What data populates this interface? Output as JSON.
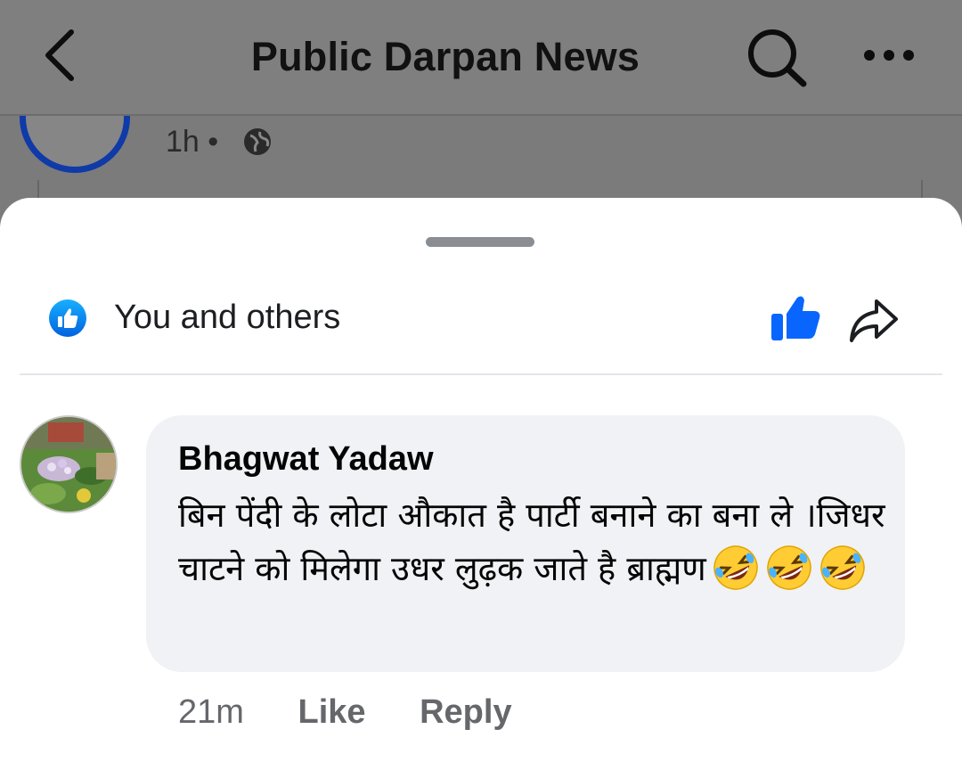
{
  "header": {
    "title": "Public Darpan News",
    "back_icon": "chevron-left-icon",
    "search_icon": "search-icon",
    "more_icon": "more-horizontal-icon"
  },
  "background_post": {
    "time": "1h",
    "separator": "•",
    "visibility_icon": "globe-icon"
  },
  "sheet": {
    "reactions_text": "You and others",
    "reaction_icon": "like-reaction-icon",
    "like_icon": "thumbs-up-icon",
    "share_icon": "share-icon",
    "accent": "#1877f2"
  },
  "comment": {
    "author": "Bhagwat Yadaw",
    "text": "बिन पेंदी के लोटा औकात है पार्टी बनाने का बना ले ।जिधर चाटने को मिलेगा उधर लुढ़क जाते है ब्राह्मण",
    "emoji_icon": "rolling-on-floor-laughing-emoji",
    "emoji_count": 3,
    "time": "21m",
    "like_label": "Like",
    "reply_label": "Reply"
  }
}
